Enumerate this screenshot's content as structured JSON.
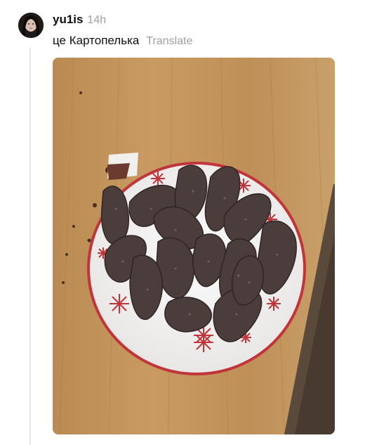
{
  "post": {
    "username": "yu1is",
    "timestamp": "14h",
    "caption": "це Картопелька",
    "translate_label": "Translate"
  },
  "photo": {
    "icon": "photo-of-chocolate-potato-cakes-on-plate"
  },
  "colors": {
    "username": "#111111",
    "muted_text": "#9aa0a6",
    "thread_line": "#e4e6ea"
  }
}
